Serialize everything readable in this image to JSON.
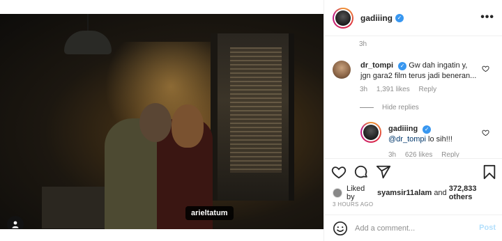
{
  "media": {
    "tag_label": "arieltatum"
  },
  "header": {
    "username": "gadiiing",
    "verified": true,
    "more": "•••"
  },
  "comments": {
    "top_time": "3h",
    "first": {
      "username": "dr_tompi",
      "verified": true,
      "text": "Gw dah ingatin y, jgn gara2 film terus jadi beneran...",
      "time": "3h",
      "likes": "1,391 likes",
      "reply": "Reply"
    },
    "hide_replies": "Hide replies",
    "reply": {
      "username": "gadiiing",
      "verified": true,
      "mention": "@dr_tompi",
      "text": "lo sih!!!",
      "time": "3h",
      "likes": "626 likes",
      "reply": "Reply"
    }
  },
  "likes": {
    "prefix": "Liked by",
    "user": "syamsir11alam",
    "joiner": "and",
    "count": "372,833 others"
  },
  "time_ago": "3 HOURS AGO",
  "add_comment": {
    "placeholder": "Add a comment...",
    "post_label": "Post"
  },
  "colors": {
    "accent_blue": "#3897f0",
    "post_disabled": "#b2dffc",
    "text_muted": "#8e8e8e"
  }
}
